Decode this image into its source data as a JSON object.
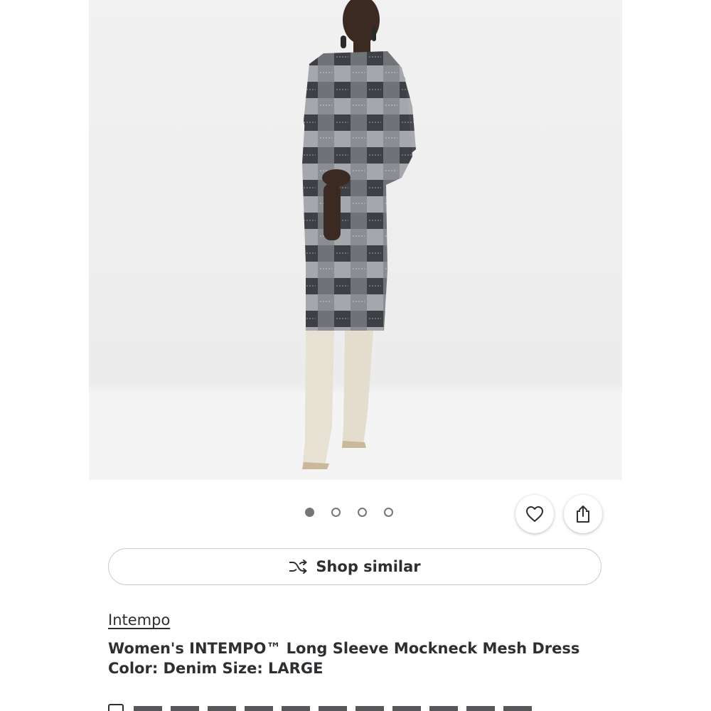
{
  "product_image": {
    "alt": "",
    "background_color": "#efefef"
  },
  "carousel": {
    "dots": [
      {
        "active": true
      },
      {
        "active": false
      },
      {
        "active": false
      },
      {
        "active": false
      }
    ]
  },
  "actions": {
    "favorite_icon": "heart-icon",
    "share_icon": "share-icon"
  },
  "shop_similar": {
    "label": "Shop similar",
    "icon": "shuffle-icon"
  },
  "product": {
    "brand": "Intempo",
    "title": "Women's INTEMPO™ Long Sleeve Mockneck Mesh Dress Color: Denim Size: LARGE"
  },
  "colors": {
    "text": "#2e2f32",
    "dot": "#74767c",
    "border": "#c9cacd"
  }
}
